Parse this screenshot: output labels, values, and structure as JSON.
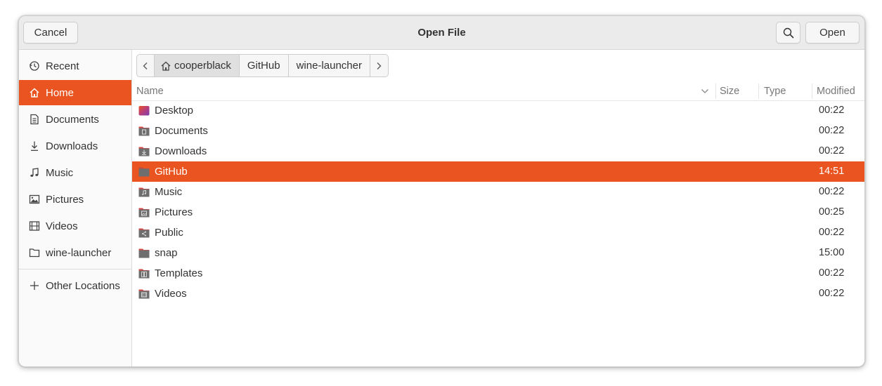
{
  "header": {
    "title": "Open File",
    "cancel_label": "Cancel",
    "open_label": "Open"
  },
  "sidebar": {
    "items": [
      {
        "label": "Recent",
        "icon": "clock-icon"
      },
      {
        "label": "Home",
        "icon": "home-icon",
        "active": true
      },
      {
        "label": "Documents",
        "icon": "document-icon"
      },
      {
        "label": "Downloads",
        "icon": "download-icon"
      },
      {
        "label": "Music",
        "icon": "music-icon"
      },
      {
        "label": "Pictures",
        "icon": "picture-icon"
      },
      {
        "label": "Videos",
        "icon": "film-icon"
      },
      {
        "label": "wine-launcher",
        "icon": "folder-icon"
      }
    ],
    "other_locations_label": "Other Locations"
  },
  "pathbar": {
    "segments": [
      "cooperblack",
      "GitHub",
      "wine-launcher"
    ],
    "current_index": 0
  },
  "columns": {
    "name": "Name",
    "size": "Size",
    "type": "Type",
    "modified": "Modified"
  },
  "files": [
    {
      "name": "Desktop",
      "modified": "00:22",
      "icon": "desktop-folder-icon"
    },
    {
      "name": "Documents",
      "modified": "00:22",
      "icon": "documents-folder-icon"
    },
    {
      "name": "Downloads",
      "modified": "00:22",
      "icon": "downloads-folder-icon"
    },
    {
      "name": "GitHub",
      "modified": "14:51",
      "icon": "folder-icon",
      "selected": true
    },
    {
      "name": "Music",
      "modified": "00:22",
      "icon": "music-folder-icon"
    },
    {
      "name": "Pictures",
      "modified": "00:25",
      "icon": "pictures-folder-icon"
    },
    {
      "name": "Public",
      "modified": "00:22",
      "icon": "public-folder-icon"
    },
    {
      "name": "snap",
      "modified": "15:00",
      "icon": "folder-icon"
    },
    {
      "name": "Templates",
      "modified": "00:22",
      "icon": "templates-folder-icon"
    },
    {
      "name": "Videos",
      "modified": "00:22",
      "icon": "videos-folder-icon"
    }
  ],
  "colors": {
    "accent": "#e95420",
    "folder": "#6e6e6e",
    "folder_tab": "#d44a45"
  }
}
